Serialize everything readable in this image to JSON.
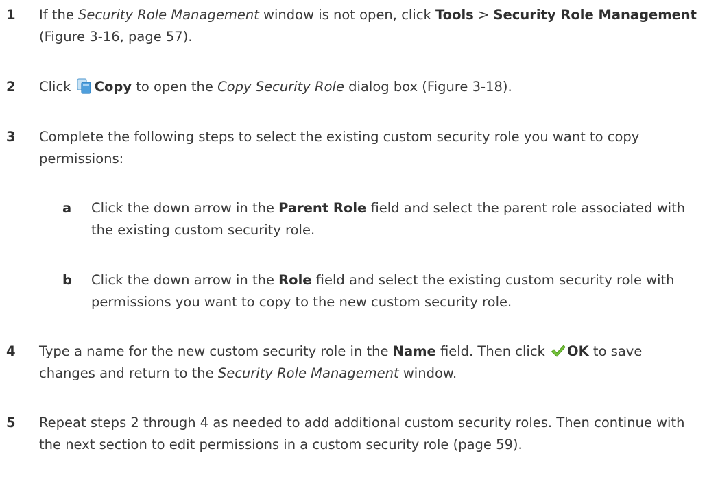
{
  "steps": [
    {
      "num": "1",
      "t1": "If the ",
      "i1": "Security Role Management",
      "t2": " window is not open, click ",
      "b1": "Tools",
      "t3": " > ",
      "b2": "Security Role Management",
      "t4": " (Figure 3-16, page 57)."
    },
    {
      "num": "2",
      "t1": "Click ",
      "icon": "copy-icon",
      "b1": "Copy",
      "t2": " to open the ",
      "i1": "Copy Security Role",
      "t3": " dialog box (Figure 3-18)."
    },
    {
      "num": "3",
      "t1": "Complete the following steps to select the existing custom security role you want to copy permissions:",
      "substeps": [
        {
          "num": "a",
          "t1": "Click the down arrow in the ",
          "b1": "Parent Role",
          "t2": " field and select the parent role associated with the existing custom security role."
        },
        {
          "num": "b",
          "t1": "Click the down arrow in the ",
          "b1": "Role",
          "t2": " field and select the existing custom security role with permissions you want to copy to the new custom security role."
        }
      ]
    },
    {
      "num": "4",
      "t1": "Type a name for the new custom security role in the ",
      "b1": "Name",
      "t2": " field. Then click ",
      "icon": "checkmark-icon",
      "b2": "OK",
      "t3": " to save changes and return to the ",
      "i1": "Security Role Management",
      "t4": " window."
    },
    {
      "num": "5",
      "t1": "Repeat steps 2 through 4 as needed to add additional custom security roles. Then continue with the next section to edit permissions in a custom security role (page 59)."
    }
  ],
  "colors": {
    "text": "#3a3a3a",
    "copy_icon": "#5aa6dd",
    "checkmark_icon": "#6cbf2e"
  }
}
